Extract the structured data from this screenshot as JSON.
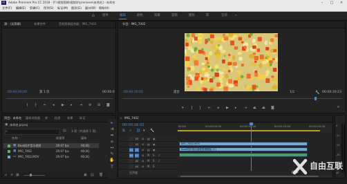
{
  "window": {
    "title": "Adobe Premiere Pro CC 2018 - [F:\\视频剪辑\\视频学\\premiere\\未命名] - 未命名"
  },
  "menu": [
    "文件(F)",
    "编辑(E)",
    "剪辑(C)",
    "序列(S)",
    "标记(M)",
    "图形(G)",
    "窗口(W)",
    "帮助(H)"
  ],
  "workspaces": [
    "组件",
    "编辑",
    "颜色",
    "效果",
    "音频",
    "图形",
    "库",
    "全部"
  ],
  "active_workspace": "编辑",
  "source": {
    "tabs": [
      "源：(无剪辑)",
      "效果控件",
      "音频剪辑混合器：IMG_7402"
    ],
    "timecode_left": "00;00;00;00",
    "page": "第 1 页",
    "timecode_right": "00:00:0"
  },
  "program": {
    "tab": "节目：IMG_7402",
    "timecode_left": "00:00:16:02",
    "fit": "适合",
    "zoom": "1/2",
    "timecode_right": "00:00:16:23"
  },
  "project": {
    "tabs": [
      "项目：未命名",
      "媒体浏览器",
      "库",
      "信息",
      "效果",
      "标记"
    ],
    "file": "未命名.prproj",
    "count": "1 项（共选择 1 项）",
    "search_placeholder": "",
    "columns": {
      "name": "名称",
      "rate": "帧速率",
      "media": "媒体"
    },
    "items": [
      {
        "name": "Beat同步音乐视频",
        "rate": "29.97 fps",
        "media": "00;00;",
        "color": "#5fb36f",
        "selected": true
      },
      {
        "name": "IMG_7402",
        "rate": "29.97 fps",
        "media": "00;00;",
        "color": "#5fb36f",
        "selected": false
      },
      {
        "name": "IMG_7402.MOV",
        "rate": "29.97 fps",
        "media": "00;00;",
        "color": "#7aa7d0",
        "selected": false
      }
    ]
  },
  "timeline": {
    "tab": "IMG_7402",
    "timecode": "00:00:16:02",
    "ruler": [
      "00:00",
      "00:00:05:00",
      "00:00:10:00",
      "00:00:15:00",
      "00:00:20:00"
    ],
    "tracks": [
      {
        "id": "V3",
        "kind": "video"
      },
      {
        "id": "V2",
        "kind": "video"
      },
      {
        "id": "V1",
        "kind": "video"
      },
      {
        "id": "A1",
        "kind": "audio"
      },
      {
        "id": "A2",
        "kind": "audio"
      },
      {
        "id": "A3",
        "kind": "audio"
      }
    ],
    "clips": [
      {
        "label": "IMG_7402.MOV",
        "track": "V2",
        "type": "v"
      },
      {
        "label": "Beat同步音乐视频剪辑模板 [V]",
        "track": "V1",
        "type": "v"
      }
    ],
    "master": "主声道"
  },
  "meters": {
    "scale": [
      "0",
      "-12",
      "-24",
      "-36",
      "-48",
      "dB"
    ]
  },
  "watermark": {
    "text": "自由互联",
    "sub": "php"
  }
}
